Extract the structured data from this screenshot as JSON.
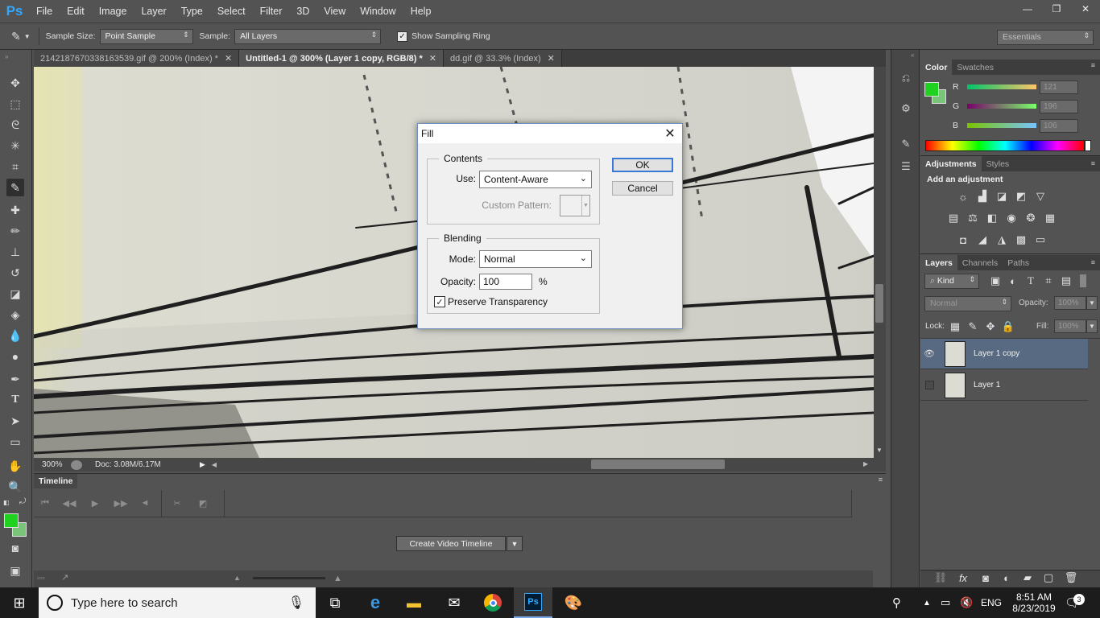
{
  "app": {
    "logo": "Ps",
    "menu": [
      "File",
      "Edit",
      "Image",
      "Layer",
      "Type",
      "Select",
      "Filter",
      "3D",
      "View",
      "Window",
      "Help"
    ],
    "window_controls": {
      "minimize": "—",
      "restore": "❐",
      "close": "✕"
    }
  },
  "options": {
    "sample_size_label": "Sample Size:",
    "sample_size_value": "Point Sample",
    "sample_label": "Sample:",
    "sample_value": "All Layers",
    "show_ring_label": "Show Sampling Ring",
    "show_ring_checked": true,
    "workspace": "Essentials"
  },
  "tabs": [
    {
      "label": "2142187670338163539.gif @ 200% (Index) *",
      "active": false
    },
    {
      "label": "Untitled-1 @ 300% (Layer 1 copy, RGB/8) *",
      "active": true
    },
    {
      "label": "dd.gif @ 33.3% (Index)",
      "active": false
    }
  ],
  "status": {
    "zoom": "300%",
    "doc": "Doc: 3.08M/6.17M"
  },
  "timeline": {
    "tab_label": "Timeline",
    "create_button": "Create Video Timeline"
  },
  "color_panel": {
    "tabs": [
      "Color",
      "Swatches"
    ],
    "fg_color": "#1fd21f",
    "bg_color": "#79c479",
    "r": {
      "label": "R",
      "value": "121"
    },
    "g": {
      "label": "G",
      "value": "196"
    },
    "b": {
      "label": "B",
      "value": "106"
    }
  },
  "adjustments_panel": {
    "tabs": [
      "Adjustments",
      "Styles"
    ],
    "heading": "Add an adjustment"
  },
  "layers_panel": {
    "tabs": [
      "Layers",
      "Channels",
      "Paths"
    ],
    "kind_label": "Kind",
    "blend_mode": "Normal",
    "opacity_label": "Opacity:",
    "opacity_value": "100%",
    "lock_label": "Lock:",
    "fill_label": "Fill:",
    "fill_value": "100%",
    "layers": [
      {
        "name": "Layer 1 copy",
        "visible": true,
        "selected": true
      },
      {
        "name": "Layer 1",
        "visible": false,
        "selected": false
      }
    ]
  },
  "fill_dialog": {
    "title": "Fill",
    "contents_legend": "Contents",
    "use_label": "Use:",
    "use_value": "Content-Aware",
    "custom_pattern_label": "Custom Pattern:",
    "blending_legend": "Blending",
    "mode_label": "Mode:",
    "mode_value": "Normal",
    "opacity_label": "Opacity:",
    "opacity_value": "100",
    "opacity_unit": "%",
    "preserve_label": "Preserve Transparency",
    "preserve_checked": true,
    "ok_label": "OK",
    "cancel_label": "Cancel"
  },
  "taskbar": {
    "search_placeholder": "Type here to search",
    "lang": "ENG",
    "time": "8:51 AM",
    "date": "8/23/2019",
    "notif_count": "3"
  }
}
